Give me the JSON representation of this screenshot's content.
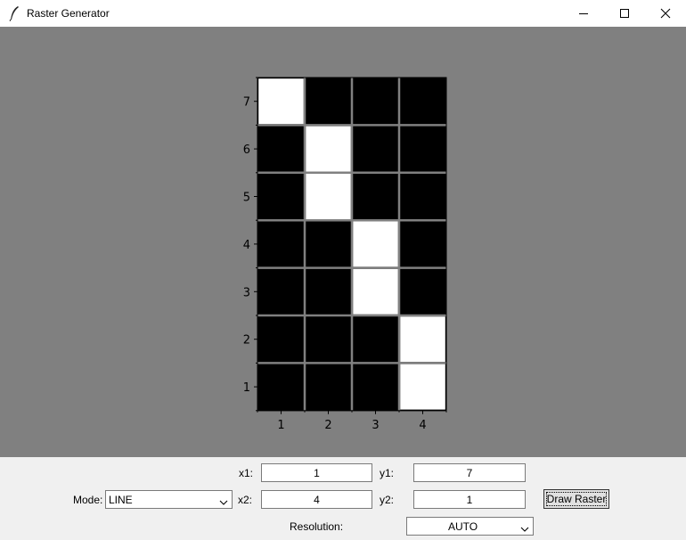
{
  "window": {
    "title": "Raster Generator",
    "controls": {
      "minimize": "minimize",
      "maximize": "maximize",
      "close": "close"
    }
  },
  "canvas": {
    "background": "#808080"
  },
  "chart_data": {
    "type": "heatmap",
    "x_ticks": [
      "1",
      "2",
      "3",
      "4"
    ],
    "y_ticks": [
      "1",
      "2",
      "3",
      "4",
      "5",
      "6",
      "7"
    ],
    "columns": 4,
    "rows": 7,
    "filled_color": "#ffffff",
    "empty_color": "#000000",
    "grid_color": "#808080",
    "filled_cells": [
      [
        1,
        7
      ],
      [
        2,
        6
      ],
      [
        2,
        5
      ],
      [
        3,
        4
      ],
      [
        3,
        3
      ],
      [
        4,
        2
      ],
      [
        4,
        1
      ]
    ]
  },
  "form": {
    "x1_label": "x1:",
    "x1_value": "1",
    "y1_label": "y1:",
    "y1_value": "7",
    "mode_label": "Mode:",
    "mode_value": "LINE",
    "x2_label": "x2:",
    "x2_value": "4",
    "y2_label": "y2:",
    "y2_value": "1",
    "draw_button": "Draw Raster",
    "resolution_label": "Resolution:",
    "resolution_value": "AUTO"
  }
}
